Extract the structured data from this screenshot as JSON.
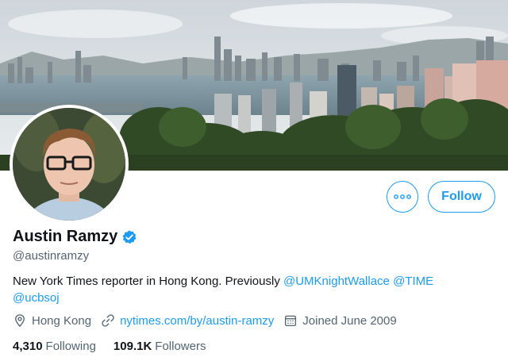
{
  "profile": {
    "name": "Austin Ramzy",
    "handle": "@austinramzy",
    "bio_text": "New York Times reporter in Hong Kong. Previously ",
    "bio_mentions": [
      "@UMKnightWallace",
      "@TIME",
      "@ucbsoj"
    ],
    "location": "Hong Kong",
    "website": "nytimes.com/by/austin-ramzy",
    "joined": "Joined June 2009",
    "following_count": "4,310",
    "following_label": "Following",
    "followers_count": "109.1K",
    "followers_label": "Followers"
  },
  "actions": {
    "follow_label": "Follow",
    "more_icon": "more-horizontal-icon"
  },
  "colors": {
    "accent": "#1d9bf0",
    "secondary_text": "#536471",
    "primary_text": "#0f1419"
  }
}
